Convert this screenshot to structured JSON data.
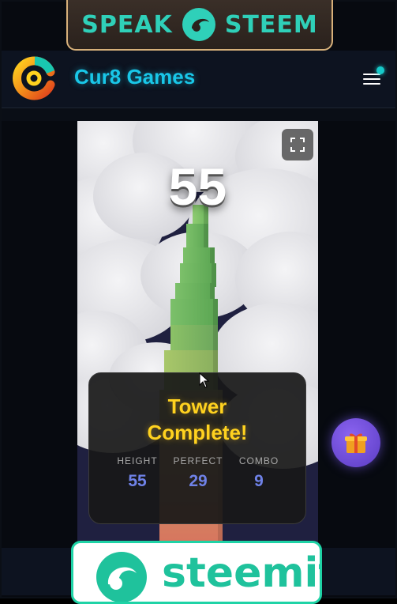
{
  "ad_top": {
    "word_left": "SPEAK",
    "word_right": "STEEM"
  },
  "header": {
    "title": "Cur8 Games",
    "menu_icon": "hamburger-icon"
  },
  "game": {
    "score": "55",
    "fullscreen_icon": "fullscreen-icon",
    "result": {
      "title_line1": "Tower",
      "title_line2": "Complete!",
      "stats": [
        {
          "label": "HEIGHT",
          "value": "55"
        },
        {
          "label": "PERFECT",
          "value": "29"
        },
        {
          "label": "COMBO",
          "value": "9"
        }
      ]
    }
  },
  "gift_button": {
    "icon": "gift-icon"
  },
  "ad_bottom": {
    "word": "steemit"
  },
  "colors": {
    "accent": "#19c7e8",
    "title_yellow": "#ffd21f",
    "stat_blue": "#6f82e8",
    "steem_green": "#1fc29c"
  }
}
